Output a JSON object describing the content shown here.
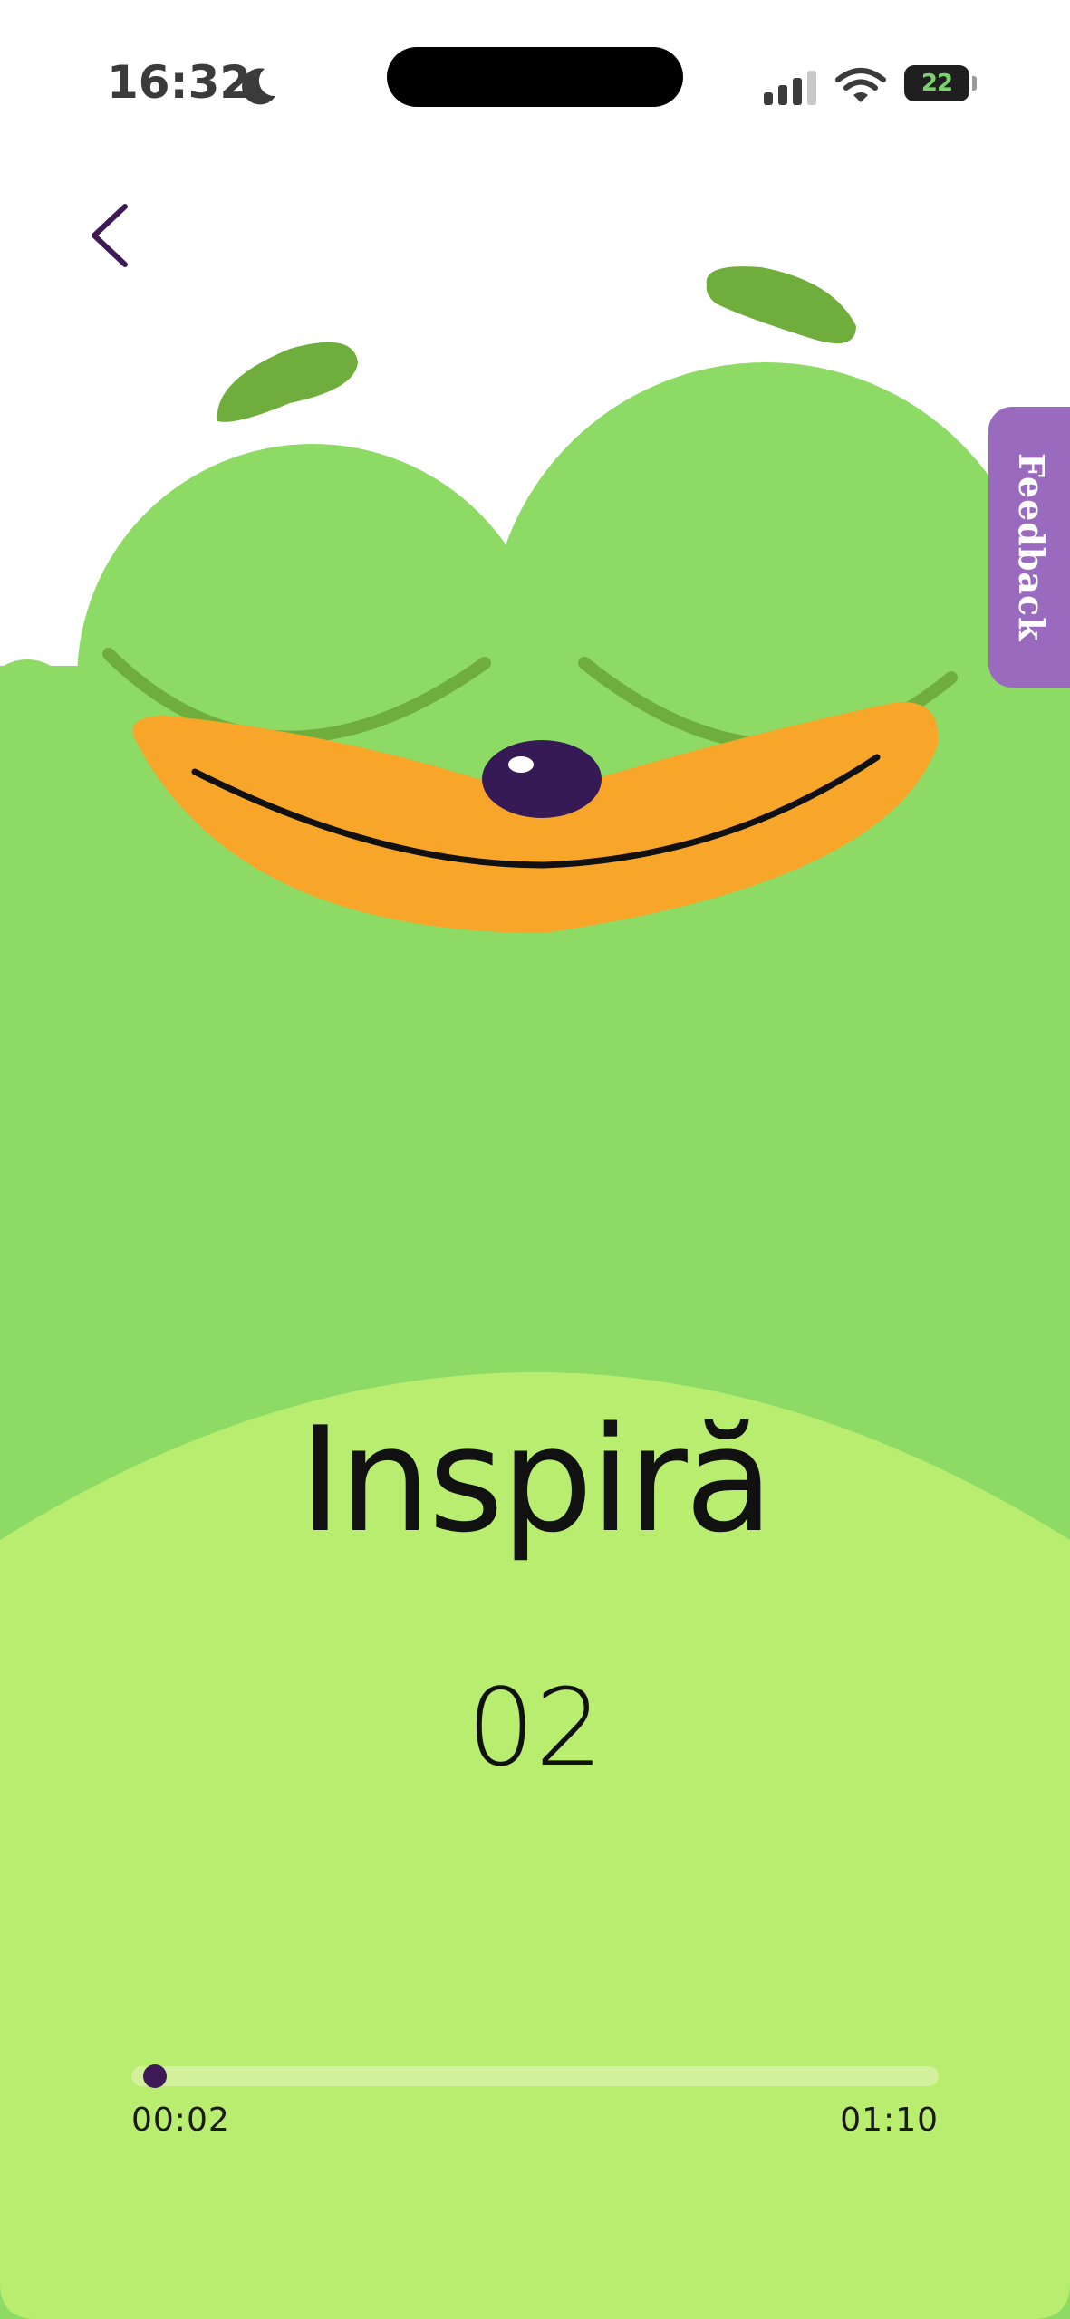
{
  "status_bar": {
    "time": "16:32",
    "battery": "22",
    "icons": [
      "moon-icon",
      "cellular-signal-icon",
      "wifi-icon",
      "battery-charging-icon"
    ]
  },
  "nav": {
    "back_icon": "chevron-left-icon"
  },
  "feedback": {
    "label": "Feedback"
  },
  "exercise": {
    "phase": "Inspiră",
    "count": "02"
  },
  "player": {
    "elapsed": "00:02",
    "total": "01:10",
    "progress_fraction": 0.029
  },
  "colors": {
    "frog_body": "#8ddb65",
    "frog_belly": "#b8ed70",
    "frog_brow": "#6fae3c",
    "mouth": "#f7a62a",
    "nose": "#361a56",
    "feedback_tab": "#9a6abf",
    "accent": "#3d1a55"
  }
}
